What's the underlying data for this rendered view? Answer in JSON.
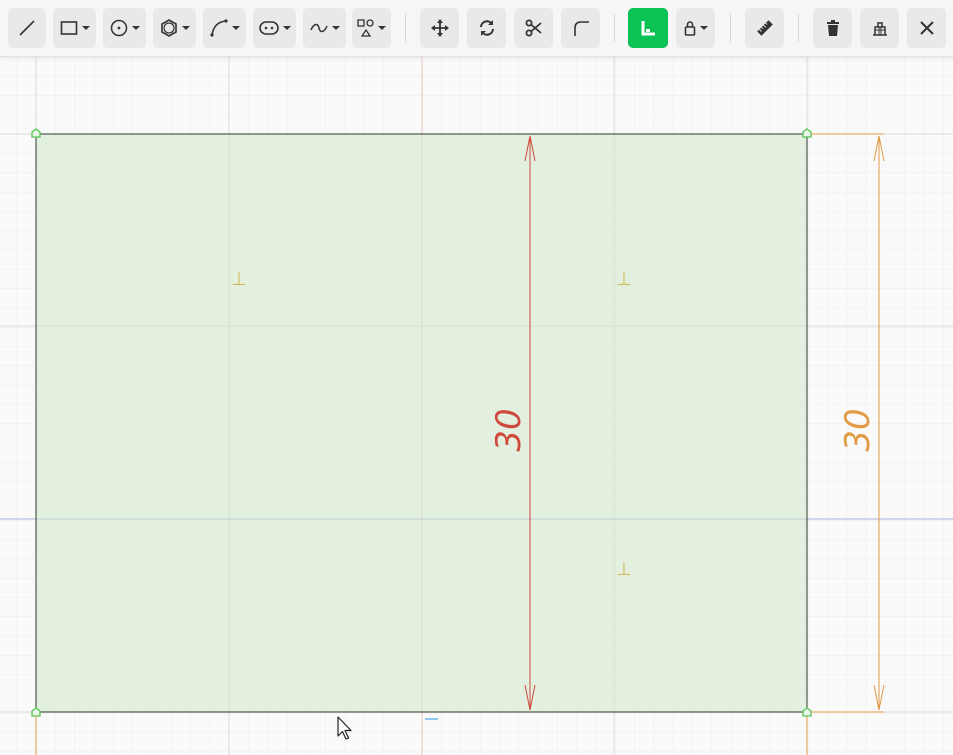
{
  "toolbar": {
    "tools": [
      {
        "name": "line-tool",
        "icon": "line-icon",
        "has_dropdown": false
      },
      {
        "name": "rectangle-tool",
        "icon": "rectangle-icon",
        "has_dropdown": true
      },
      {
        "name": "circle-tool",
        "icon": "circle-icon",
        "has_dropdown": true
      },
      {
        "name": "polygon-tool",
        "icon": "hexagon-icon",
        "has_dropdown": true
      },
      {
        "name": "arc-tool",
        "icon": "arc-icon",
        "has_dropdown": true
      },
      {
        "name": "slot-tool",
        "icon": "slot-icon",
        "has_dropdown": true
      },
      {
        "name": "spline-tool",
        "icon": "spline-icon",
        "has_dropdown": true
      },
      {
        "name": "shapes-tool",
        "icon": "shapes-icon",
        "has_dropdown": true
      },
      {
        "name": "move-tool",
        "icon": "move-icon",
        "has_dropdown": false
      },
      {
        "name": "rotate-tool",
        "icon": "rotate-icon",
        "has_dropdown": false
      },
      {
        "name": "trim-tool",
        "icon": "scissors-icon",
        "has_dropdown": false
      },
      {
        "name": "fillet-tool",
        "icon": "fillet-icon",
        "has_dropdown": false
      },
      {
        "name": "constraint-tool",
        "icon": "constraint-icon",
        "has_dropdown": false,
        "active": true
      },
      {
        "name": "lock-tool",
        "icon": "lock-icon",
        "has_dropdown": true
      },
      {
        "name": "measure-tool",
        "icon": "ruler-icon",
        "has_dropdown": false
      },
      {
        "name": "delete-tool",
        "icon": "trash-icon",
        "has_dropdown": false
      },
      {
        "name": "construction-tool",
        "icon": "construction-icon",
        "has_dropdown": false
      },
      {
        "name": "close-button",
        "icon": "close-icon",
        "has_dropdown": false
      }
    ]
  },
  "sketch": {
    "dimension_inner": "30",
    "dimension_outer": "30",
    "constraint_symbol": "⊥"
  },
  "colors": {
    "accent_green": "#0bc254",
    "fill": "#e0f0de",
    "dimension_red": "#cf4a3c",
    "dimension_orange": "#e29a45",
    "constraint_yellow": "#d2bc5a",
    "axis_blue": "#a9b2e0",
    "axis_red": "#eec3bf"
  }
}
